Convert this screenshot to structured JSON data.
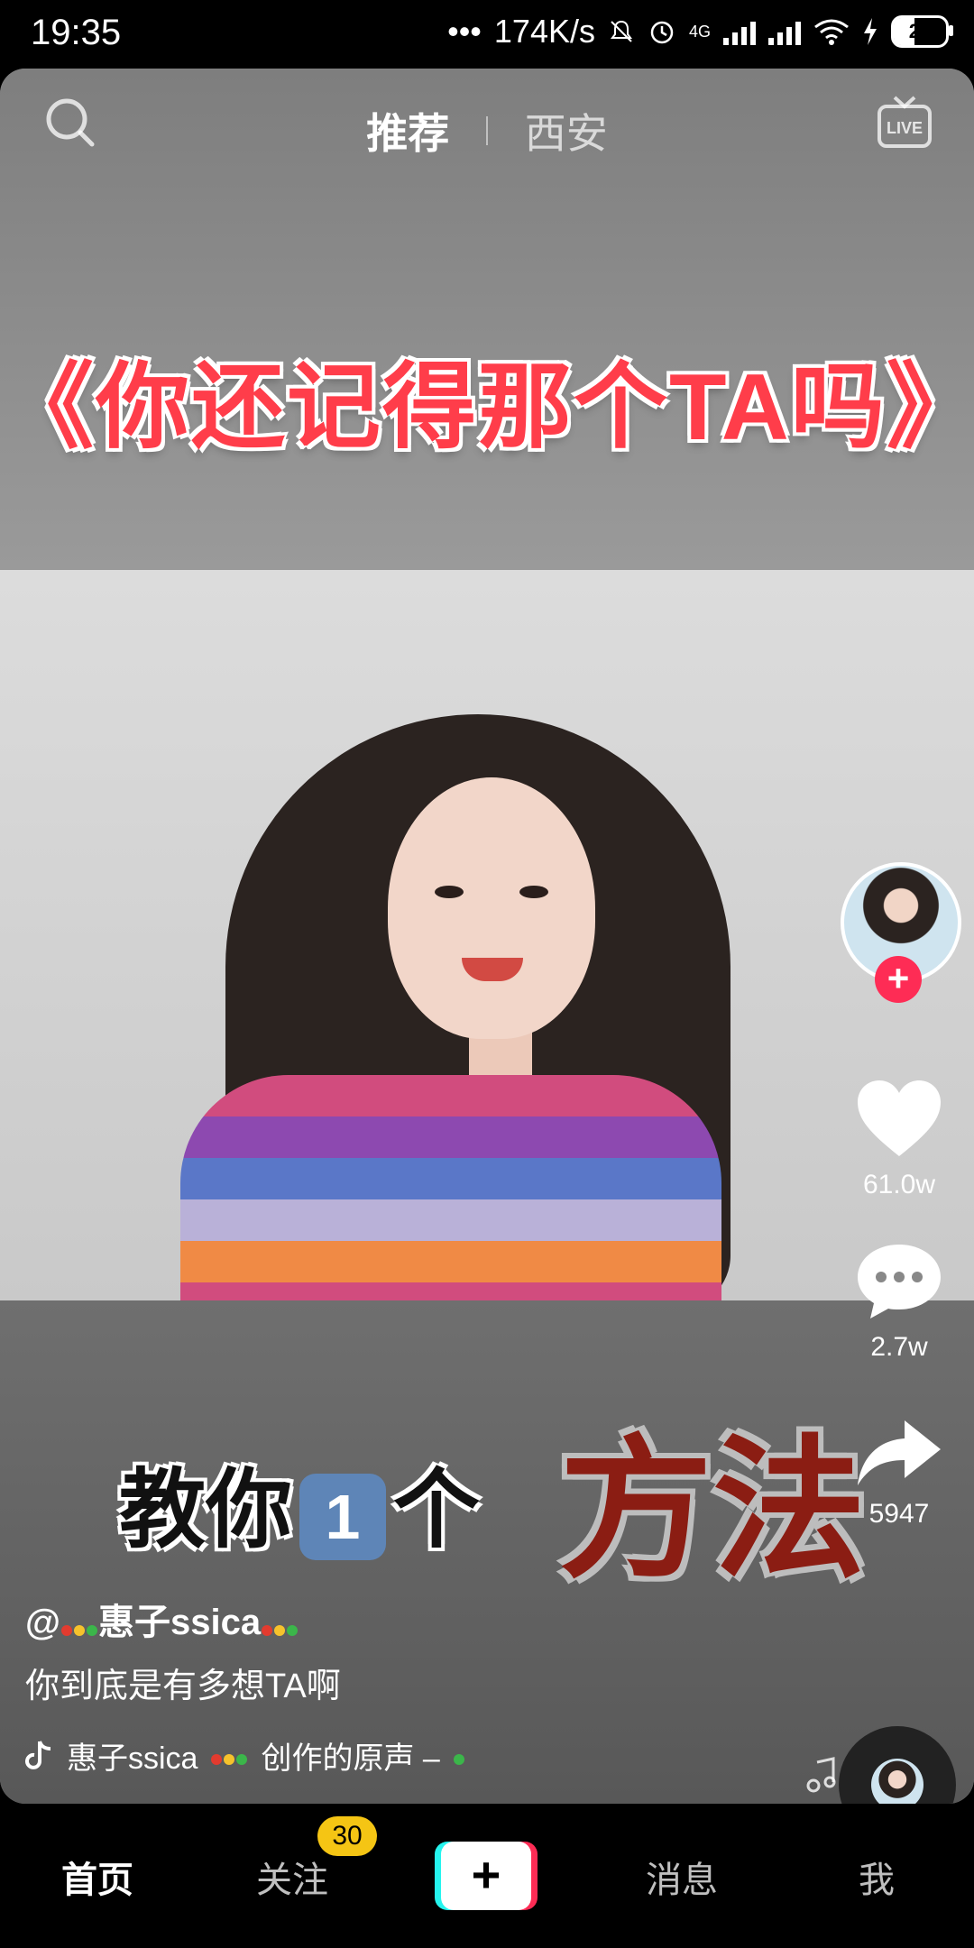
{
  "status_bar": {
    "time": "19:35",
    "network_speed": "174K/s",
    "network_type": "4G",
    "battery": "25"
  },
  "top_nav": {
    "tabs": [
      {
        "label": "推荐",
        "active": true
      },
      {
        "label": "西安",
        "active": false
      }
    ],
    "search_icon": "search-icon",
    "live_icon": "live-icon",
    "live_label": "LIVE"
  },
  "video": {
    "headline": "《你还记得那个TA吗》",
    "overlay_left": "教你",
    "overlay_num": "1",
    "overlay_left_suffix": "个",
    "overlay_right": "方法"
  },
  "side_actions": {
    "likes": "61.0w",
    "comments": "2.7w",
    "shares": "5947"
  },
  "post": {
    "author_prefix": "@",
    "author_name": "惠子ssica",
    "caption": "你到底是有多想TA啊",
    "music": "惠子ssica",
    "music_suffix": "创作的原声 –"
  },
  "bottom_nav": {
    "items": [
      {
        "label": "首页",
        "active": true
      },
      {
        "label": "关注",
        "active": false
      },
      {
        "label": "消息",
        "active": false
      },
      {
        "label": "我",
        "active": false
      }
    ],
    "follow_badge": "30",
    "add_label": "+"
  },
  "colors": {
    "accent_red": "#fe2c55",
    "accent_cyan": "#25f4ee",
    "badge_yellow": "#f5c514"
  }
}
